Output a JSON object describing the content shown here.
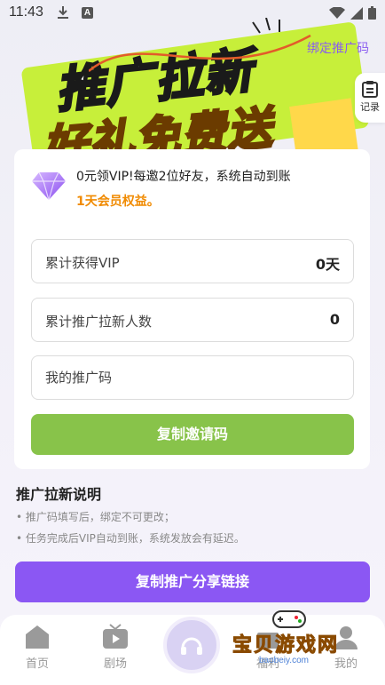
{
  "status_bar": {
    "time": "11:43",
    "notif_icon": "A"
  },
  "hero": {
    "title_line1": "推广拉新",
    "title_line2": "好礼免费送",
    "bind_link": "绑定推广码",
    "record_label": "记录"
  },
  "card": {
    "promo_line1": "0元领VIP!每邀2位好友，系统自动到账",
    "promo_line2": "1天会员权益。",
    "stats": [
      {
        "label": "累计获得VIP",
        "value": "0天"
      },
      {
        "label": "累计推广拉新人数",
        "value": "0"
      }
    ],
    "code_placeholder": "我的推广码",
    "copy_invite_label": "复制邀请码"
  },
  "rules": {
    "title": "推广拉新说明",
    "items": [
      "• 推广码填写后，绑定不可更改；",
      "• 任务完成后VIP自动到账，系统发放会有延迟。"
    ]
  },
  "share_button_label": "复制推广分享链接",
  "bottom_nav": {
    "items": [
      {
        "label": "首页",
        "icon": "home-icon"
      },
      {
        "label": "剧场",
        "icon": "tv-icon"
      },
      {
        "label": "福利",
        "icon": "center-icon"
      },
      {
        "label": "我的",
        "icon": "profile-icon"
      }
    ]
  },
  "watermark": {
    "text": "宝贝游戏网",
    "sub": "baobeiy.com"
  },
  "colors": {
    "accent_purple": "#8b57f3",
    "accent_green": "#88c34a",
    "highlight_orange": "#f08a00"
  }
}
